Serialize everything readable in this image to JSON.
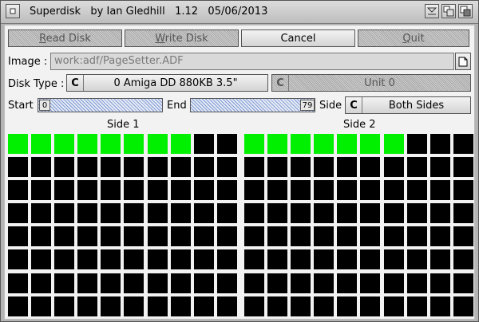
{
  "window": {
    "title": "Superdisk   by Ian Gledhill   1.12   05/06/2013"
  },
  "toolbar": {
    "read_label": "Read Disk",
    "write_label": "Write Disk",
    "cancel_label": "Cancel",
    "quit_label": "Quit"
  },
  "image": {
    "label": "Image :",
    "value": "work:adf/PageSetter.ADF"
  },
  "disktype": {
    "label": "Disk Type :",
    "type_value": "0 Amiga DD 880KB 3.5\"",
    "unit_value": "Unit 0"
  },
  "range": {
    "start_label": "Start",
    "start_value": "0",
    "end_label": "End",
    "end_value": "79",
    "side_label": "Side",
    "side_value": "Both Sides"
  },
  "tracks": {
    "side1_label": "Side 1",
    "side2_label": "Side 2",
    "columns": 10,
    "rows": 8,
    "side1_done": 8,
    "side2_done": 7,
    "done_color": "#00f000",
    "pending_color": "#000000"
  },
  "icons": [
    "zoom-icon",
    "depth-icon",
    "iconify-icon",
    "close-icon",
    "file-icon",
    "cycle-icon"
  ]
}
